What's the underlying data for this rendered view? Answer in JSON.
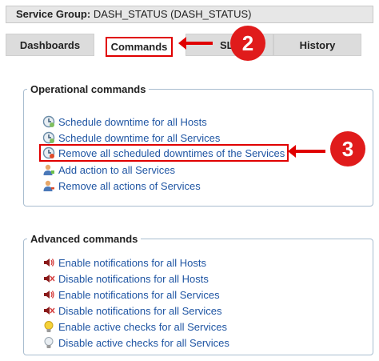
{
  "header": {
    "label": "Service Group:",
    "value": "DASH_STATUS (DASH_STATUS)"
  },
  "tabs": [
    {
      "label": "Dashboards"
    },
    {
      "label": "Commands"
    },
    {
      "label": "SL"
    },
    {
      "label": "History"
    }
  ],
  "operational": {
    "legend": "Operational commands",
    "items": [
      {
        "label": "Schedule downtime for all Hosts",
        "icon": "clock-icon"
      },
      {
        "label": "Schedule downtime for all Services",
        "icon": "clock-icon"
      },
      {
        "label": "Remove all scheduled downtimes of the Services",
        "icon": "clock-remove-icon"
      },
      {
        "label": "Add action to all Services",
        "icon": "user-add-icon"
      },
      {
        "label": "Remove all actions of Services",
        "icon": "user-remove-icon"
      }
    ]
  },
  "advanced": {
    "legend": "Advanced commands",
    "items": [
      {
        "label": "Enable notifications for all Hosts",
        "icon": "speaker-on-icon"
      },
      {
        "label": "Disable notifications for all Hosts",
        "icon": "speaker-off-icon"
      },
      {
        "label": "Enable notifications for all Services",
        "icon": "speaker-on-icon"
      },
      {
        "label": "Disable notifications for all Services",
        "icon": "speaker-off-icon"
      },
      {
        "label": "Enable active checks for all Services",
        "icon": "bulb-on-icon"
      },
      {
        "label": "Disable active checks for all Services",
        "icon": "bulb-off-icon"
      }
    ]
  },
  "callouts": [
    {
      "number": "2"
    },
    {
      "number": "3"
    }
  ],
  "colors": {
    "accent_red": "#e00000",
    "link_blue": "#1f55a3",
    "fieldset_border": "#a9bdd0"
  }
}
